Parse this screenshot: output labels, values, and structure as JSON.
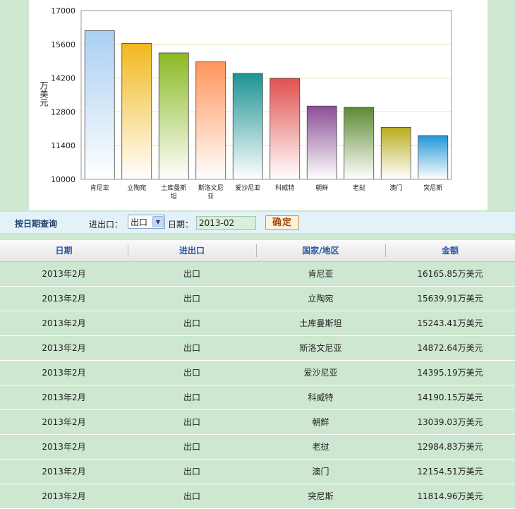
{
  "chart_data": {
    "type": "bar",
    "ylabel": "万美元",
    "ylim": [
      10000,
      17000
    ],
    "yticks": [
      10000,
      11400,
      12800,
      14200,
      15600,
      17000
    ],
    "categories": [
      "肯尼亚",
      "立陶宛",
      "土库曼斯坦",
      "斯洛文尼亚",
      "爱沙尼亚",
      "科威特",
      "朝鲜",
      "老挝",
      "澳门",
      "突尼斯"
    ],
    "category_lines": [
      [
        "肯尼亚"
      ],
      [
        "立陶宛"
      ],
      [
        "土库曼斯",
        "坦"
      ],
      [
        "斯洛文尼",
        "亚"
      ],
      [
        "爱沙尼亚"
      ],
      [
        "科威特"
      ],
      [
        "朝鲜"
      ],
      [
        "老挝"
      ],
      [
        "澳门"
      ],
      [
        "突尼斯"
      ]
    ],
    "values": [
      16165.85,
      15639.91,
      15243.41,
      14872.64,
      14395.19,
      14190.15,
      13039.03,
      12984.83,
      12154.51,
      11814.96
    ],
    "colors": [
      "#a9cff2",
      "#f1b81c",
      "#8ab924",
      "#ff955a",
      "#1d9392",
      "#e05150",
      "#8a4e96",
      "#5e8a35",
      "#b8ad1e",
      "#2396d8"
    ],
    "grid": true
  },
  "query": {
    "title": "按日期查询",
    "direction_label": "进出口：",
    "direction_value": "出口",
    "date_label": "日期：",
    "date_value": "2013-02",
    "confirm_label": "确定"
  },
  "table": {
    "headers": [
      "日期",
      "进出口",
      "国家/地区",
      "金额"
    ],
    "rows": [
      [
        "2013年2月",
        "出口",
        "肯尼亚",
        "16165.85万美元"
      ],
      [
        "2013年2月",
        "出口",
        "立陶宛",
        "15639.91万美元"
      ],
      [
        "2013年2月",
        "出口",
        "土库曼斯坦",
        "15243.41万美元"
      ],
      [
        "2013年2月",
        "出口",
        "斯洛文尼亚",
        "14872.64万美元"
      ],
      [
        "2013年2月",
        "出口",
        "爱沙尼亚",
        "14395.19万美元"
      ],
      [
        "2013年2月",
        "出口",
        "科威特",
        "14190.15万美元"
      ],
      [
        "2013年2月",
        "出口",
        "朝鲜",
        "13039.03万美元"
      ],
      [
        "2013年2月",
        "出口",
        "老挝",
        "12984.83万美元"
      ],
      [
        "2013年2月",
        "出口",
        "澳门",
        "12154.51万美元"
      ],
      [
        "2013年2月",
        "出口",
        "突尼斯",
        "11814.96万美元"
      ]
    ]
  }
}
